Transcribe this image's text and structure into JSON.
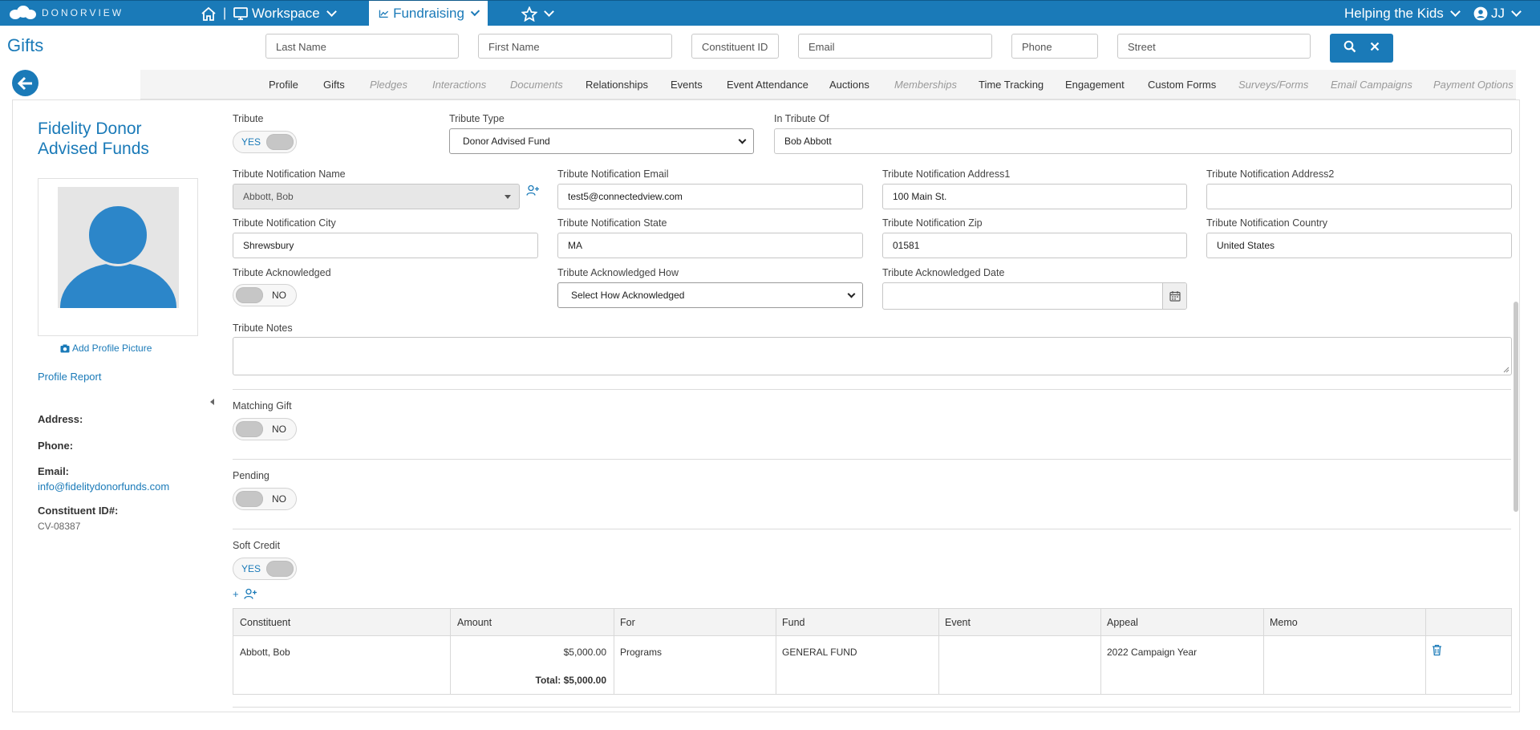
{
  "topbar": {
    "logo_text": "DONORVIEW",
    "workspace_label": "Workspace",
    "fundraising_label": "Fundraising",
    "org_label": "Helping the Kids",
    "user_label": "JJ",
    "separator": "|"
  },
  "header": {
    "page_title": "Gifts",
    "search": {
      "last_name": "Last Name",
      "first_name": "First Name",
      "constituent_id": "Constituent ID",
      "email": "Email",
      "phone": "Phone",
      "street": "Street"
    }
  },
  "tabs": [
    {
      "label": "Profile",
      "disabled": false
    },
    {
      "label": "Gifts",
      "disabled": false
    },
    {
      "label": "Pledges",
      "disabled": true
    },
    {
      "label": "Interactions",
      "disabled": true
    },
    {
      "label": "Documents",
      "disabled": true
    },
    {
      "label": "Relationships",
      "disabled": false
    },
    {
      "label": "Events",
      "disabled": false
    },
    {
      "label": "Event Attendance",
      "disabled": false
    },
    {
      "label": "Auctions",
      "disabled": false
    },
    {
      "label": "Memberships",
      "disabled": true
    },
    {
      "label": "Time Tracking",
      "disabled": false
    },
    {
      "label": "Engagement",
      "disabled": false
    },
    {
      "label": "Custom Forms",
      "disabled": false
    },
    {
      "label": "Surveys/Forms",
      "disabled": true
    },
    {
      "label": "Email Campaigns",
      "disabled": true
    },
    {
      "label": "Payment Options",
      "disabled": true
    }
  ],
  "profile": {
    "name": "Fidelity Donor Advised Funds",
    "add_picture": "Add Profile Picture",
    "report_link": "Profile Report",
    "address_label": "Address:",
    "phone_label": "Phone:",
    "email_label": "Email:",
    "email_value": "info@fidelitydonorfunds.com",
    "cid_label": "Constituent ID#:",
    "cid_value": "CV-08387"
  },
  "form": {
    "tribute_label": "Tribute",
    "tribute_toggle": "YES",
    "tribute_type_label": "Tribute Type",
    "tribute_type_value": "Donor Advised Fund",
    "in_tribute_of_label": "In Tribute Of",
    "in_tribute_of_value": "Bob Abbott",
    "notif_name_label": "Tribute Notification Name",
    "notif_name_value": "Abbott, Bob",
    "notif_email_label": "Tribute Notification Email",
    "notif_email_value": "test5@connectedview.com",
    "notif_addr1_label": "Tribute Notification Address1",
    "notif_addr1_value": "100 Main St.",
    "notif_addr2_label": "Tribute Notification Address2",
    "notif_addr2_value": "",
    "notif_city_label": "Tribute Notification City",
    "notif_city_value": "Shrewsbury",
    "notif_state_label": "Tribute Notification State",
    "notif_state_value": "MA",
    "notif_zip_label": "Tribute Notification Zip",
    "notif_zip_value": "01581",
    "notif_country_label": "Tribute Notification Country",
    "notif_country_value": "United States",
    "ack_label": "Tribute Acknowledged",
    "ack_toggle": "NO",
    "ack_how_label": "Tribute Acknowledged How",
    "ack_how_value": "Select How Acknowledged",
    "ack_date_label": "Tribute Acknowledged Date",
    "ack_date_value": "",
    "notes_label": "Tribute Notes",
    "matching_label": "Matching Gift",
    "matching_toggle": "NO",
    "pending_label": "Pending",
    "pending_toggle": "NO",
    "soft_credit_label": "Soft Credit",
    "soft_credit_toggle": "YES",
    "add_plus": "+"
  },
  "soft_credit_table": {
    "headers": [
      "Constituent",
      "Amount",
      "For",
      "Fund",
      "Event",
      "Appeal",
      "Memo"
    ],
    "row": {
      "constituent": "Abbott, Bob",
      "amount": "$5,000.00",
      "for": "Programs",
      "fund": "GENERAL FUND",
      "event": "",
      "appeal": "2022 Campaign Year",
      "memo": ""
    },
    "total": "Total: $5,000.00"
  },
  "colors": {
    "brand": "#1a7ab8",
    "toggle_on_text": "#1a7ab8"
  }
}
